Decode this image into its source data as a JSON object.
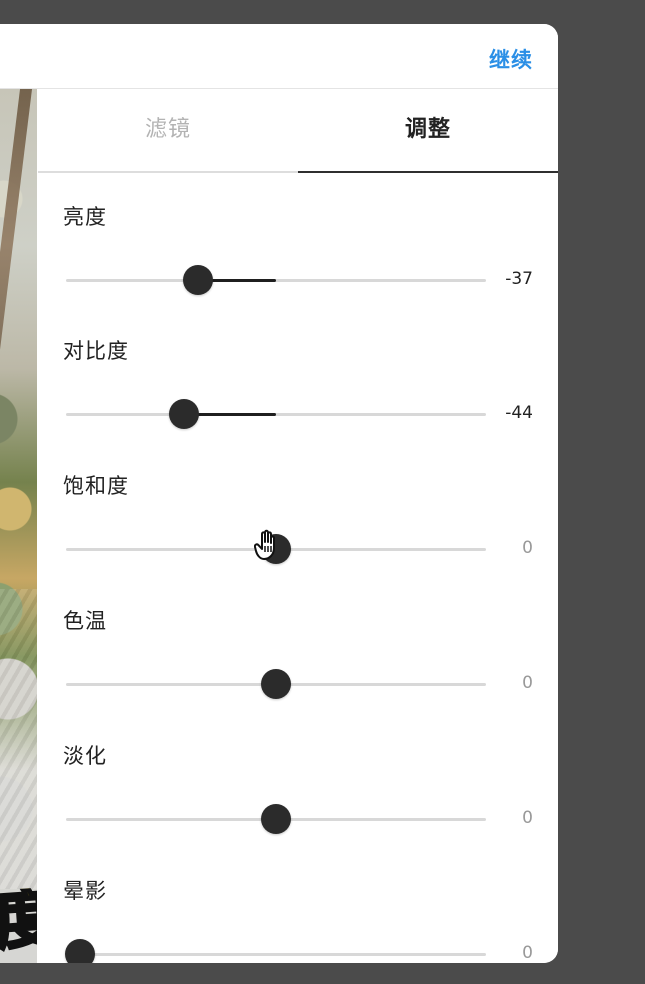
{
  "header": {
    "continue_label": "继续"
  },
  "preview": {
    "overlay_text": "度"
  },
  "tabs": [
    {
      "label": "滤镜",
      "active": false
    },
    {
      "label": "调整",
      "active": true
    }
  ],
  "adjustments": [
    {
      "label": "亮度",
      "value": "-37",
      "level": -0.37
    },
    {
      "label": "对比度",
      "value": "-44",
      "level": -0.44
    },
    {
      "label": "饱和度",
      "value": "0",
      "level": 0
    },
    {
      "label": "色温",
      "value": "0",
      "level": 0
    },
    {
      "label": "淡化",
      "value": "0",
      "level": 0
    },
    {
      "label": "晕影",
      "value": "0",
      "level": 0
    }
  ],
  "colors": {
    "accent": "#2b8fe6",
    "slider_thumb": "#2b2b2b",
    "track": "#d8d8d8"
  }
}
